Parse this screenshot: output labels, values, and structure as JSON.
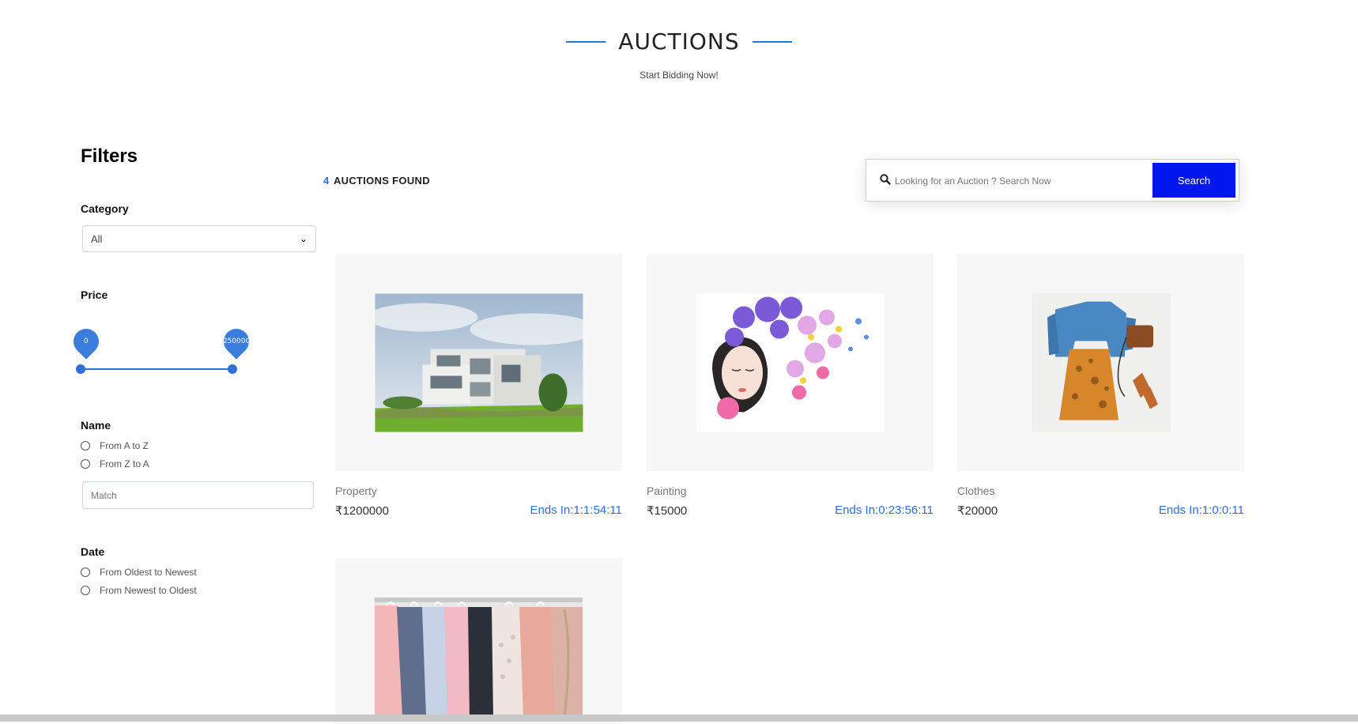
{
  "header": {
    "title": "AUCTIONS",
    "subtitle": "Start Bidding Now!"
  },
  "filters": {
    "title": "Filters",
    "category": {
      "label": "Category",
      "selected": "All"
    },
    "price": {
      "label": "Price",
      "min_value": "0",
      "max_value": "250000"
    },
    "name": {
      "label": "Name",
      "options": [
        "From A to Z",
        "From Z to A"
      ],
      "match_placeholder": "Match"
    },
    "date": {
      "label": "Date",
      "options": [
        "From Oldest to Newest",
        "From Newest to Oldest"
      ]
    }
  },
  "results": {
    "count": "4",
    "count_label": "AUCTIONS FOUND"
  },
  "search": {
    "placeholder": "Looking for an Auction ? Search Now",
    "button_label": "Search"
  },
  "auctions": [
    {
      "name": "Property",
      "price": "₹1200000",
      "ends": "Ends In:1:1:54:11",
      "image": "modern-house-photo"
    },
    {
      "name": "Painting",
      "price": "₹15000",
      "ends": "Ends In:0:23:56:11",
      "image": "flower-girl-painting"
    },
    {
      "name": "Clothes",
      "price": "₹20000",
      "ends": "Ends In:1:0:0:11",
      "image": "outfit-flatlay-photo"
    },
    {
      "name": "",
      "price": "",
      "ends": "",
      "image": "clothes-rack-photo"
    }
  ],
  "colors": {
    "accent": "#2f6fd6",
    "search_button": "#0017ee",
    "card_bg": "#f7f7f7"
  }
}
